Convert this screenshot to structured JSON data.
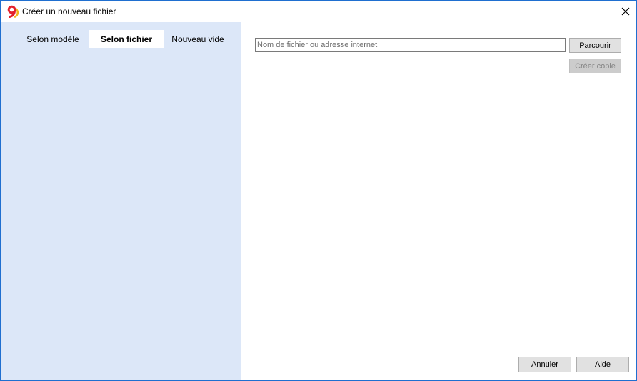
{
  "window": {
    "title": "Créer un nouveau fichier",
    "accent_color": "#1f6fd0",
    "app_icon": "softmaker-9-icon",
    "close_icon": "close-icon"
  },
  "tabs": [
    {
      "label": "Selon modèle",
      "active": false
    },
    {
      "label": "Selon fichier",
      "active": true
    },
    {
      "label": "Nouveau vide",
      "active": false
    }
  ],
  "file": {
    "path_value": "",
    "path_placeholder": "Nom de fichier ou adresse internet",
    "browse_label": "Parcourir",
    "copy_label": "Créer copie",
    "copy_enabled": false
  },
  "footer": {
    "cancel_label": "Annuler",
    "help_label": "Aide"
  },
  "colors": {
    "left_panel_bg": "#dce7f8",
    "active_tab_bg": "#ffffff"
  }
}
